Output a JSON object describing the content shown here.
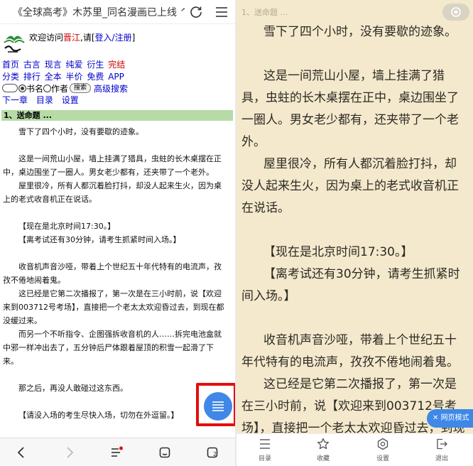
{
  "browser": {
    "page_title": "《全球高考》木苏里_同名漫画已上线 ^...",
    "refresh_icon": "refresh-icon",
    "menu_icon": "hamburger-menu-icon"
  },
  "site": {
    "welcome_prefix": "欢迎访问",
    "site_name": "晋江",
    "welcome_mid": ",请[",
    "login_register": "登入/注册",
    "welcome_suffix": "]",
    "nav_row1": [
      "首页",
      "古言",
      "现言",
      "纯爱",
      "衍生"
    ],
    "nav_row1_highlight": "完结",
    "nav_row2": [
      "分类",
      "排行",
      "全本",
      "半价",
      "免费",
      "APP"
    ],
    "search_option_book": "书名",
    "search_option_author": "作者",
    "search_button": "搜索",
    "advanced_search": "高级搜索",
    "nav_row3": [
      "下一章",
      "目录",
      "设置"
    ]
  },
  "chapter": {
    "heading": "1、送命题 ...",
    "left_paragraphs": [
      {
        "text": "雪下了四个小时，没有要歇的迹象。",
        "gap": false
      },
      {
        "text": "这是一间荒山小屋，墙上挂满了猎具，虫蛀的长木桌摆在正中，桌边围坐了一圈人。男女老少都有，还夹带了一个老外。",
        "gap": true
      },
      {
        "text": "屋里很冷，所有人都沉着脸打抖，却没人起来生火，因为桌上的老式收音机正在说话。",
        "gap": false
      },
      {
        "text": "【现在是北京时间17:30。】",
        "gap": true
      },
      {
        "text": "【离考试还有30分钟，请考生抓紧时间入场。】",
        "gap": false
      },
      {
        "text": "收音机声音沙哑，带着上个世纪五十年代特有的电流声，孜孜不倦地闹着鬼。",
        "gap": true
      },
      {
        "text": "这已经是它第二次播报了，第一次是在三小时前，说【欢迎来到003712号考场】，直接把一个老太太欢迎昏过去，到现在都没缓过来。",
        "gap": false
      },
      {
        "text": "而另一个不听指令、企图强拆收音机的人……拆完电池盒就中邪一样冲出去了，五分钟后尸体跟着屋顶的积雪一起滑了下来。",
        "gap": false
      },
      {
        "text": "那之后，再没人敢碰过这东西。",
        "gap": true
      },
      {
        "text": "【请没入场的考生尽快入场，切勿在外逗留。】",
        "gap": true
      }
    ]
  },
  "left_bottom_bar": {
    "icons": [
      "back-arrow-icon",
      "forward-arrow-icon",
      "menu-list-icon",
      "home-icon",
      "tabs-icon"
    ],
    "tab_count": "2"
  },
  "reader": {
    "header": "1、送命题 ...",
    "paragraphs": [
      {
        "text": "雪下了四个小时，没有要歇的迹象。",
        "gap": false
      },
      {
        "text": "这是一间荒山小屋，墙上挂满了猎具，虫蛀的长木桌摆在正中，桌边围坐了一圈人。男女老少都有，还夹带了一个老外。",
        "gap": true
      },
      {
        "text": "屋里很冷，所有人都沉着脸打抖，却没人起来生火，因为桌上的老式收音机正在说话。",
        "gap": false
      },
      {
        "text": "【现在是北京时间17:30。】",
        "gap": true
      },
      {
        "text": "【离考试还有30分钟，请考生抓紧时间入场。】",
        "gap": false
      },
      {
        "text": "收音机声音沙哑，带着上个世纪五十年代特有的电流声，孜孜不倦地闹着鬼。",
        "gap": true
      },
      {
        "text": "这已经是它第二次播报了，第一次是在三小时前，说【欢迎来到003712号考场】，直接把一个老太太欢迎昏过去，到现在都没缓过来。",
        "gap": false
      }
    ],
    "web_mode_label": "网页模式",
    "tabs": [
      {
        "label": "目录",
        "icon": "toc-icon"
      },
      {
        "label": "收藏",
        "icon": "star-icon"
      },
      {
        "label": "设置",
        "icon": "settings-icon"
      },
      {
        "label": "退出",
        "icon": "exit-icon"
      }
    ]
  },
  "colors": {
    "accent": "#3f88e8",
    "highlight_border": "#e40d0d",
    "reader_background": "#f4e9cc",
    "chapter_bar": "#b6dba6",
    "link": "#0000cc",
    "site_red": "#cc0000"
  }
}
